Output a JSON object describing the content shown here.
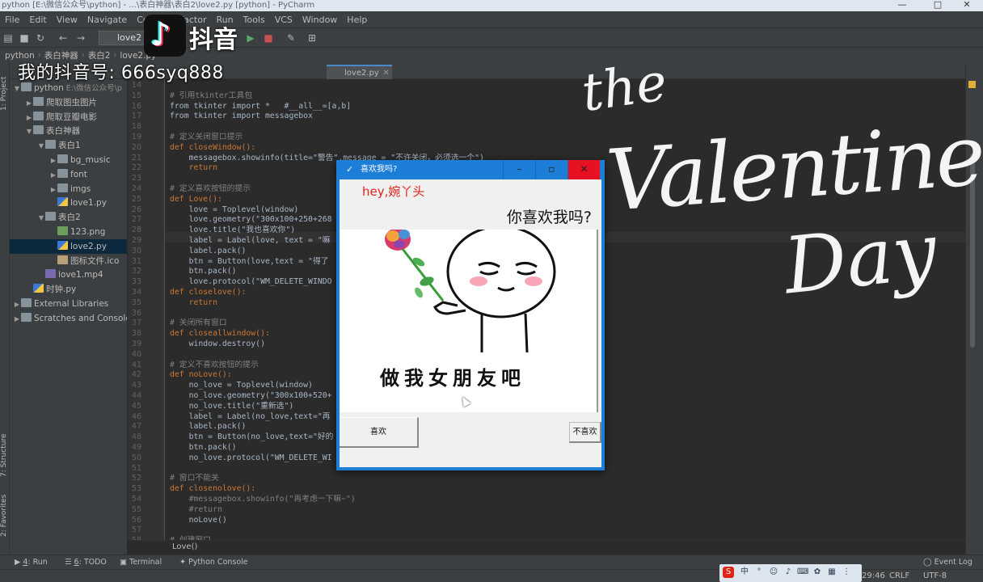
{
  "window": {
    "title": "python [E:\\微信公众号\\python] - ...\\表白神器\\表白2\\love2.py [python] - PyCharm"
  },
  "menu": [
    "File",
    "Edit",
    "View",
    "Navigate",
    "Code",
    "Refactor",
    "Run",
    "Tools",
    "VCS",
    "Window",
    "Help"
  ],
  "toolbar": {
    "run_config": "love2",
    "icons": [
      "open-icon",
      "save-icon",
      "sync-icon",
      "back-icon",
      "forward-icon",
      "run-icon",
      "stop-icon",
      "wrench-icon",
      "sdk-icon"
    ]
  },
  "navbar": {
    "crumbs": [
      "python",
      "表白神器",
      "表白2",
      "love2.py"
    ]
  },
  "left_strip": {
    "project_label": "1: Project",
    "structure_label": "7: Structure",
    "favorites_label": "2: Favorites"
  },
  "project_tree": [
    {
      "label": "python",
      "path": "E:\\微信公众号\\p",
      "type": "folder",
      "depth": 0,
      "arrow": "▼"
    },
    {
      "label": "爬取图虫图片",
      "type": "folder",
      "depth": 1,
      "arrow": "▶"
    },
    {
      "label": "爬取豆瓣电影",
      "type": "folder",
      "depth": 1,
      "arrow": "▶"
    },
    {
      "label": "表白神器",
      "type": "folder",
      "depth": 1,
      "arrow": "▼"
    },
    {
      "label": "表白1",
      "type": "folder",
      "depth": 2,
      "arrow": "▼"
    },
    {
      "label": "bg_music",
      "type": "folder",
      "depth": 3,
      "arrow": "▶"
    },
    {
      "label": "font",
      "type": "folder",
      "depth": 3,
      "arrow": "▶"
    },
    {
      "label": "imgs",
      "type": "folder",
      "depth": 3,
      "arrow": "▶"
    },
    {
      "label": "love1.py",
      "type": "py",
      "depth": 3,
      "arrow": ""
    },
    {
      "label": "表白2",
      "type": "folder",
      "depth": 2,
      "arrow": "▼"
    },
    {
      "label": "123.png",
      "type": "img",
      "depth": 3,
      "arrow": ""
    },
    {
      "label": "love2.py",
      "type": "py",
      "depth": 3,
      "arrow": "",
      "selected": true
    },
    {
      "label": "图标文件.ico",
      "type": "ico",
      "depth": 3,
      "arrow": ""
    },
    {
      "label": "love1.mp4",
      "type": "mp4",
      "depth": 2,
      "arrow": ""
    },
    {
      "label": "时钟.py",
      "type": "py",
      "depth": 1,
      "arrow": ""
    },
    {
      "label": "External Libraries",
      "type": "folder",
      "depth": 0,
      "arrow": "▶"
    },
    {
      "label": "Scratches and Consoles",
      "type": "folder",
      "depth": 0,
      "arrow": "▶"
    }
  ],
  "editor": {
    "tab_label": "love2.py",
    "line_numbers": [
      "14",
      "15",
      "16",
      "17",
      "18",
      "19",
      "20",
      "21",
      "22",
      "23",
      "24",
      "25",
      "26",
      "27",
      "28",
      "29",
      "30",
      "31",
      "32",
      "33",
      "34",
      "35",
      "36",
      "37",
      "38",
      "39",
      "40",
      "41",
      "42",
      "43",
      "44",
      "45",
      "46",
      "47",
      "48",
      "49",
      "50",
      "51",
      "52",
      "53",
      "54",
      "55",
      "56",
      "57",
      "58"
    ],
    "lines": [
      {
        "text": "",
        "cls": ""
      },
      {
        "text": "# 引用tkinter工具包",
        "cls": "cm"
      },
      {
        "text": "from tkinter import *   #__all__=[a,b]",
        "cls": ""
      },
      {
        "text": "from tkinter import messagebox",
        "cls": ""
      },
      {
        "text": "",
        "cls": ""
      },
      {
        "text": "# 定义关闭窗口提示",
        "cls": "cm"
      },
      {
        "text": "def closeWindow():",
        "cls": "kw"
      },
      {
        "text": "    messagebox.showinfo(title=\"警告\",message = \"不许关闭，必须选一个\")",
        "cls": ""
      },
      {
        "text": "    return",
        "cls": "kw"
      },
      {
        "text": "",
        "cls": ""
      },
      {
        "text": "# 定义喜欢按钮的提示",
        "cls": "cm"
      },
      {
        "text": "def Love():",
        "cls": "kw"
      },
      {
        "text": "    love = Toplevel(window)",
        "cls": ""
      },
      {
        "text": "    love.geometry(\"300x100+250+268",
        "cls": ""
      },
      {
        "text": "    love.title(\"我也喜欢你\")",
        "cls": ""
      },
      {
        "text": "    label = Label(love, text = \"嘛",
        "cls": ""
      },
      {
        "text": "    label.pack()",
        "cls": ""
      },
      {
        "text": "    btn = Button(love,text = \"得了",
        "cls": ""
      },
      {
        "text": "    btn.pack()",
        "cls": ""
      },
      {
        "text": "    love.protocol(\"WM_DELETE_WINDO",
        "cls": ""
      },
      {
        "text": "def closelove():",
        "cls": "kw"
      },
      {
        "text": "    return",
        "cls": "kw"
      },
      {
        "text": "",
        "cls": ""
      },
      {
        "text": "# 关闭所有窗口",
        "cls": "cm"
      },
      {
        "text": "def closeallwindow():",
        "cls": "kw"
      },
      {
        "text": "    window.destroy()",
        "cls": ""
      },
      {
        "text": "",
        "cls": ""
      },
      {
        "text": "# 定义不喜欢按钮的提示",
        "cls": "cm"
      },
      {
        "text": "def noLove():",
        "cls": "kw"
      },
      {
        "text": "    no_love = Toplevel(window)",
        "cls": ""
      },
      {
        "text": "    no_love.geometry(\"300x100+520+",
        "cls": ""
      },
      {
        "text": "    no_love.title(\"重新选\")",
        "cls": ""
      },
      {
        "text": "    label = Label(no_love,text=\"再",
        "cls": ""
      },
      {
        "text": "    label.pack()",
        "cls": ""
      },
      {
        "text": "    btn = Button(no_love,text=\"好的",
        "cls": ""
      },
      {
        "text": "    btn.pack()",
        "cls": ""
      },
      {
        "text": "    no_love.protocol(\"WM_DELETE_WI",
        "cls": ""
      },
      {
        "text": "",
        "cls": ""
      },
      {
        "text": "# 窗口不能关",
        "cls": "cm"
      },
      {
        "text": "def closenolove():",
        "cls": "kw"
      },
      {
        "text": "    #messagebox.showinfo(\"再考虑一下嘛~\")",
        "cls": "cm"
      },
      {
        "text": "    #return",
        "cls": "cm"
      },
      {
        "text": "    noLove()",
        "cls": ""
      },
      {
        "text": "",
        "cls": ""
      },
      {
        "text": "# 创建窗口",
        "cls": "cm"
      }
    ],
    "breadcrumb": "Love()"
  },
  "bottom_tools": [
    {
      "num": "4",
      "label": ": Run",
      "icon": "run-tool-icon"
    },
    {
      "num": "6",
      "label": ": TODO",
      "icon": "todo-icon"
    },
    {
      "num": "",
      "label": "Terminal",
      "icon": "terminal-icon"
    },
    {
      "num": "",
      "label": "Python Console",
      "icon": "python-console-icon"
    }
  ],
  "event_log": "Event Log",
  "status": {
    "time": "29:46",
    "line_sep": "CRLF",
    "encoding": "UTF-8"
  },
  "overlay": {
    "app_name": "抖音",
    "account": "我的抖音号: 666syq888"
  },
  "tk_window": {
    "title": "喜欢我吗?",
    "hey": "hey,婉丫头",
    "question": "你喜欢我吗?",
    "meme_caption": "做我女朋友吧",
    "like_button": "喜欢",
    "dislike_button": "不喜欢"
  },
  "colors": {
    "ide_bg": "#2b2b2b",
    "panel_bg": "#3c3f41",
    "tk_blue": "#1c7ed6",
    "tk_close": "#e81123",
    "hey_red": "#e2231a"
  }
}
